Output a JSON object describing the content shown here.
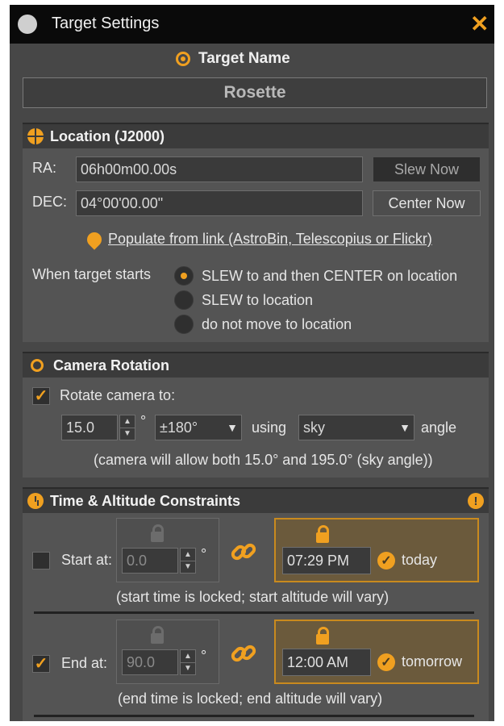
{
  "window": {
    "title": "Target Settings",
    "close": "✕"
  },
  "target_name": {
    "label": "Target Name",
    "value": "Rosette"
  },
  "location": {
    "title": "Location (J2000)",
    "ra_label": "RA:",
    "ra_value": "06h00m00.00s",
    "dec_label": "DEC:",
    "dec_value": "04°00'00.00\"",
    "slew_now": "Slew Now",
    "center_now": "Center Now",
    "populate_link": "Populate from link (AstroBin, Telescopius or Flickr)",
    "when_starts_label": "When target starts",
    "options": [
      {
        "label": "SLEW to and then CENTER on location",
        "selected": true
      },
      {
        "label": "SLEW to location",
        "selected": false
      },
      {
        "label": "do not move to location",
        "selected": false
      }
    ]
  },
  "camera_rotation": {
    "title": "Camera Rotation",
    "rotate_label": "Rotate camera to:",
    "rotate_checked": true,
    "angle_value": "15.0",
    "degree_symbol": "°",
    "range_value": "±180°",
    "using_label": "using",
    "reference_value": "sky",
    "angle_label": "angle",
    "note": "(camera will allow both 15.0° and 195.0° (sky angle))"
  },
  "constraints": {
    "title": "Time & Altitude Constraints",
    "warn": "!",
    "start": {
      "label": "Start at:",
      "checked": false,
      "altitude": "0.0",
      "degree": "°",
      "time": "07:29 PM",
      "day": "today",
      "note": "(start time is locked; start altitude will vary)"
    },
    "end": {
      "label": "End at:",
      "checked": true,
      "altitude": "90.0",
      "degree": "°",
      "time": "12:00 AM",
      "day": "tomorrow",
      "note": "(end time is locked; end altitude will vary)"
    }
  },
  "colors": {
    "accent": "#f0a020",
    "panel": "#545454",
    "header": "#3b3b3b",
    "titlebar": "#0a0a0a"
  }
}
